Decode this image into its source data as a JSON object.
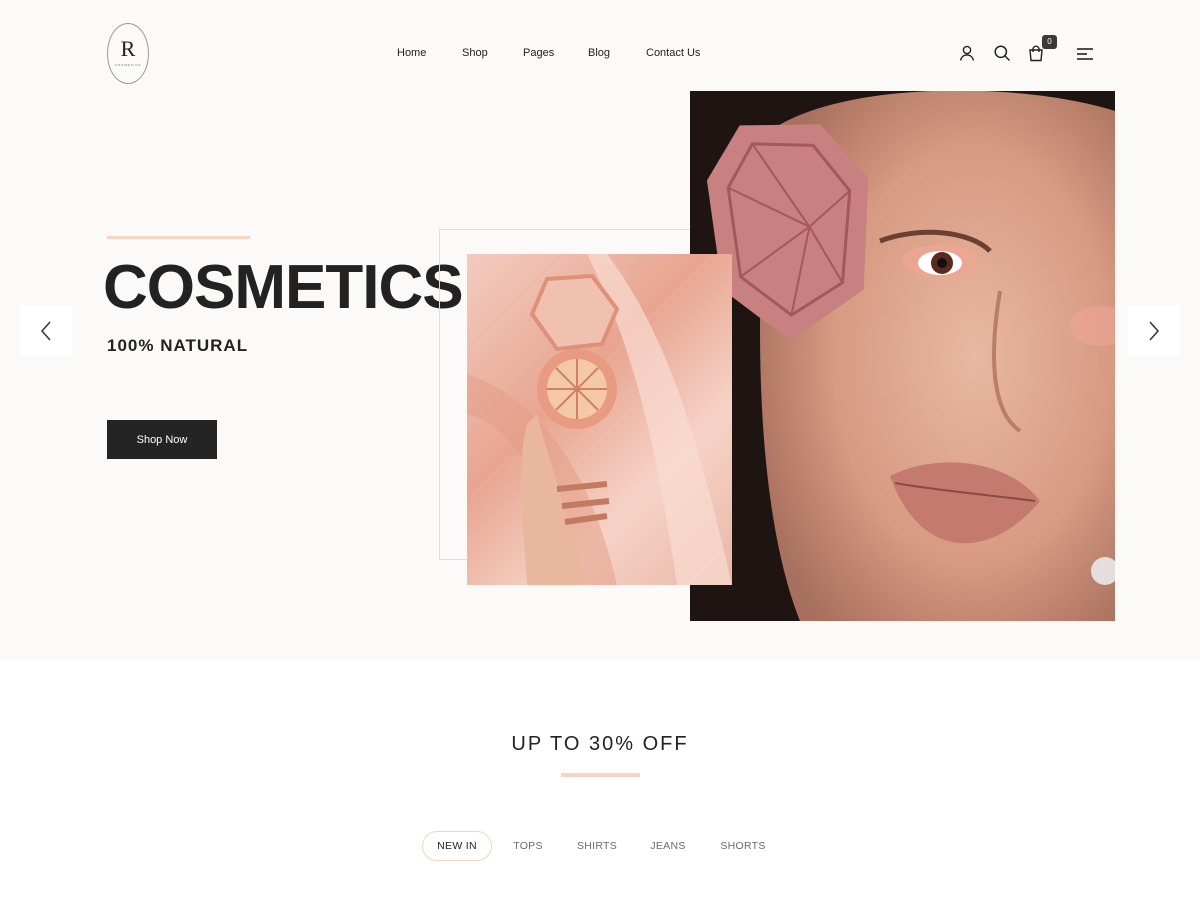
{
  "brand": {
    "logo_letter": "R",
    "logo_subtext": "COSMETICS"
  },
  "nav": {
    "items": [
      "Home",
      "Shop",
      "Pages",
      "Blog",
      "Contact Us"
    ]
  },
  "header_icons": {
    "user": "user-icon",
    "search": "search-icon",
    "cart": "cart-icon",
    "cart_count": "0",
    "menu": "menu-icon"
  },
  "hero": {
    "title": "COSMETICS",
    "subtitle": "100% NATURAL",
    "cta_label": "Shop Now"
  },
  "section": {
    "title": "UP TO 30% OFF",
    "tabs": [
      "NEW IN",
      "TOPS",
      "SHIRTS",
      "JEANS",
      "SHORTS"
    ],
    "active_tab": "NEW IN"
  },
  "colors": {
    "accent": "#f7d5c4",
    "hero_bg": "#fcfaf9",
    "button_dark": "#242424",
    "text": "#222222"
  }
}
